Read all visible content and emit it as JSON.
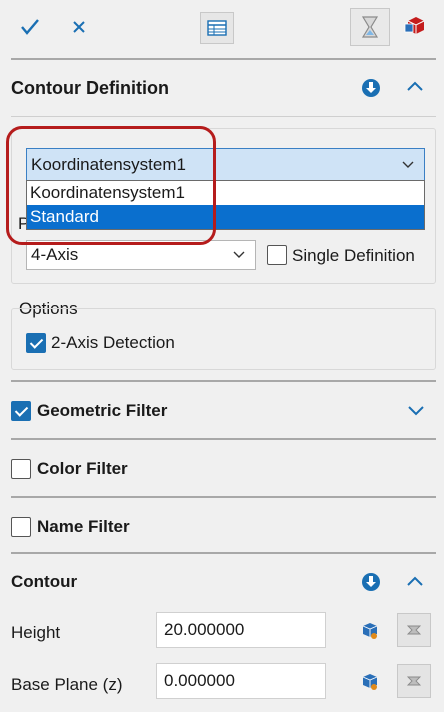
{
  "toolbar": {
    "ok_icon": "check-icon",
    "cancel_icon": "close-icon",
    "table_icon": "table-icon",
    "hourglass_icon": "hourglass-icon",
    "cube_icon": "cube-icon"
  },
  "contour_definition": {
    "title": "Contour Definition",
    "coordinate_system": {
      "selected": "Koordinatensystem1",
      "options": [
        "Koordinatensystem1",
        "Standard"
      ],
      "highlighted_option": "Standard"
    },
    "processing_type_label_partial": "P",
    "axis_mode": {
      "selected": "4-Axis"
    },
    "single_definition": {
      "label": "Single Definition",
      "checked": false
    },
    "options_label": "Options",
    "two_axis_detection": {
      "label": "2-Axis Detection",
      "checked": true
    }
  },
  "filters": {
    "geometric": {
      "label": "Geometric Filter",
      "checked": true
    },
    "color": {
      "label": "Color Filter",
      "checked": false
    },
    "name": {
      "label": "Name Filter",
      "checked": false
    }
  },
  "contour": {
    "title": "Contour",
    "height": {
      "label": "Height",
      "value": "20.000000"
    },
    "base_plane": {
      "label": "Base Plane (z)",
      "value": "0.000000"
    }
  },
  "colors": {
    "accent": "#1a6fb3",
    "selection": "#0a6fce",
    "highlight_annotation": "#b51c1c"
  }
}
